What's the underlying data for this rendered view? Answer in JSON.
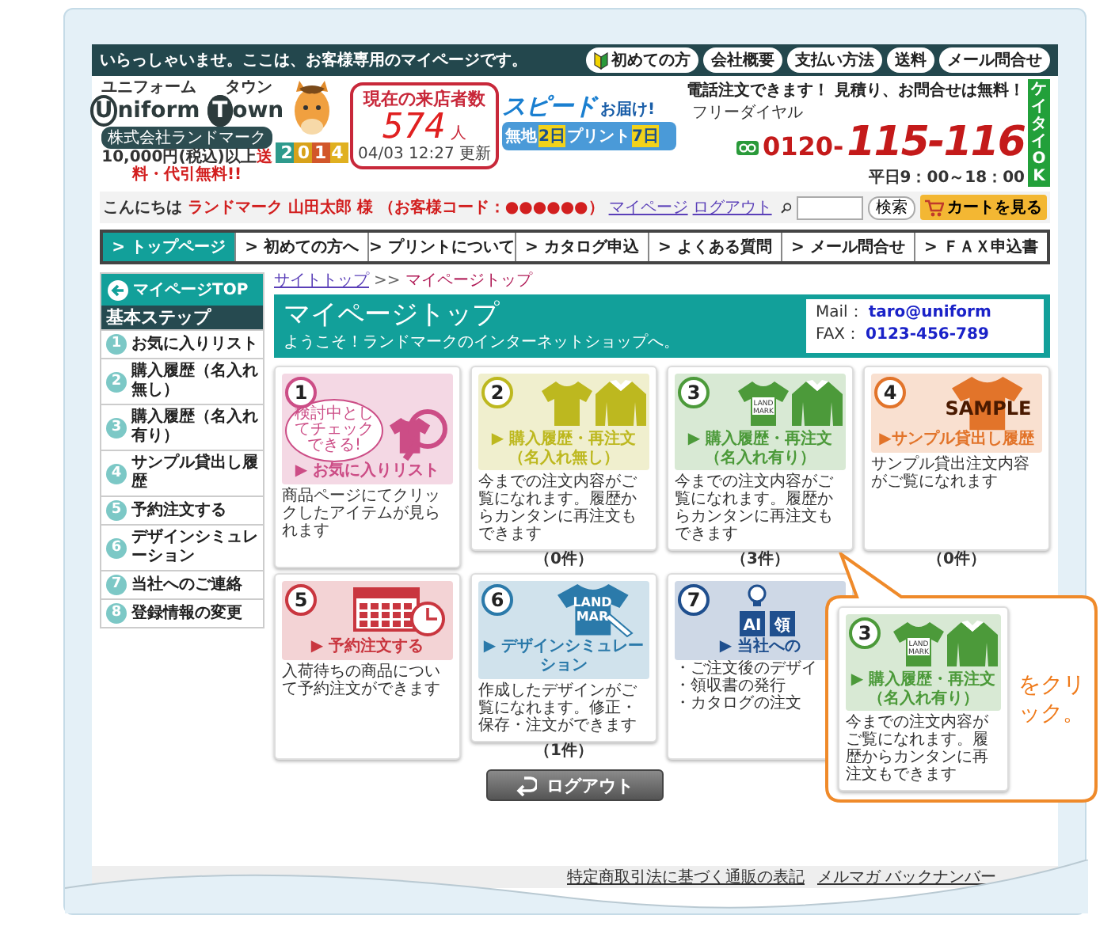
{
  "topbar": {
    "greeting": "いらっしゃいませ。ここは、お客様専用のマイページです。",
    "links": [
      {
        "label": "初めての方",
        "kind": "beginner"
      },
      {
        "label": "会社概要",
        "kind": "plain"
      },
      {
        "label": "支払い方法",
        "kind": "plain"
      },
      {
        "label": "送料",
        "kind": "plain"
      },
      {
        "label": "メール問合せ",
        "kind": "plain"
      }
    ]
  },
  "logo": {
    "kana_left": "ユニフォーム",
    "kana_right": "タウン",
    "word_left": "Uniform",
    "word_right": "Town",
    "company": "株式会社ランドマーク",
    "note": "10,000円(税込)以上",
    "note_highlight": "送料・代引無料!!"
  },
  "mascot": {
    "year": "2014"
  },
  "counter": {
    "label": "現在の来店者数",
    "count": "574",
    "unit": "人",
    "updated": "04/03 12:27 更新"
  },
  "speed_banner": {
    "title": "スピード",
    "tag": "お届け!",
    "plain": "無地",
    "plain_days": "2日",
    "print": "プリント",
    "print_days": "7日"
  },
  "phone": {
    "headline": "電話注文できます！ 見積り、お問合せは無料！",
    "label": "フリーダイヤル",
    "prefix": "0120-",
    "number": "115-116",
    "hours": "平日9：00～18：00",
    "mobile_badge": "ケイタイOK"
  },
  "user_bar": {
    "hello": "こんにちは",
    "user": "ランドマーク 山田太郎 様 （お客様コード：●●●●●●）",
    "links": [
      "マイページ",
      "ログアウト"
    ],
    "search_button": "検索",
    "cart_button": "カートを見る"
  },
  "nav": [
    {
      "label": "> トップページ",
      "selected": true
    },
    {
      "label": "> 初めての方へ",
      "selected": false
    },
    {
      "label": "> プリントについて",
      "selected": false
    },
    {
      "label": "> カタログ申込",
      "selected": false
    },
    {
      "label": "> よくある質問",
      "selected": false
    },
    {
      "label": "> メール問合せ",
      "selected": false
    },
    {
      "label": "> ＦＡＸ申込書",
      "selected": false
    }
  ],
  "sidebar": {
    "top_button": "マイページTOP",
    "heading": "基本ステップ",
    "items": [
      {
        "number": "1",
        "label": "お気に入りリスト"
      },
      {
        "number": "2",
        "label": "購入履歴（名入れ無し）"
      },
      {
        "number": "3",
        "label": "購入履歴（名入れ有り）"
      },
      {
        "number": "4",
        "label": "サンプル貸出し履歴"
      },
      {
        "number": "5",
        "label": "予約注文する"
      },
      {
        "number": "6",
        "label": "デザインシミュレーション"
      },
      {
        "number": "7",
        "label": "当社へのご連絡"
      },
      {
        "number": "8",
        "label": "登録情報の変更"
      }
    ]
  },
  "breadcrumb": [
    {
      "label": "サイトトップ",
      "kind": "link"
    },
    {
      "label": ">>",
      "kind": "separator"
    },
    {
      "label": "マイページトップ",
      "kind": "current"
    }
  ],
  "header": {
    "title": "マイページトップ",
    "subtitle": "ようこそ！ランドマークのインターネットショップへ。",
    "contacts": [
      {
        "label": "Mail：",
        "value": "taro@uniform"
      },
      {
        "label": "FAX：",
        "value": "0123-456-789"
      }
    ]
  },
  "cards": [
    {
      "number": "1",
      "kind": "favorite",
      "color": "#cc4d86",
      "art_labels": [
        "検討中としてチェックできる!"
      ],
      "title": "▶ お気に入りリスト",
      "description": "商品ページにてクリックしたアイテムが見られます"
    },
    {
      "number": "2",
      "kind": "shirts",
      "color": "#bdb81f",
      "title": "▶ 購入履歴・再注文",
      "subtitle": "（名入れ無し）",
      "description": "今までの注文内容がご覧になれます。履歴からカンタンに再注文もできます",
      "count": "（0件）"
    },
    {
      "number": "3",
      "kind": "shirts-logo",
      "color": "#4c9a3a",
      "art_labels": [
        "LAND",
        "MARK"
      ],
      "title": "▶ 購入履歴・再注文",
      "subtitle": "（名入れ有り）",
      "description": "今までの注文内容がご覧になれます。履歴からカンタンに再注文もできます",
      "count": "（3件）"
    },
    {
      "number": "4",
      "kind": "sample",
      "color": "#e2742a",
      "art_labels": [
        "SAMPLE"
      ],
      "title": "▶サンプル貸出し履歴",
      "description": "サンプル貸出注文内容がご覧になれます",
      "count": "（0件）"
    },
    {
      "number": "5",
      "kind": "calendar",
      "color": "#c9363f",
      "title": "▶ 予約注文する",
      "description": "入荷待ちの商品について予約注文ができます"
    },
    {
      "number": "6",
      "kind": "shirt-pen",
      "color": "#2b7aaa",
      "art_labels": [
        "LAND",
        "MAR"
      ],
      "title": "▶ デザインシミュレーション",
      "description": "作成したデザインがご覧になれます。修正・保存・注文ができます",
      "count": "（1件）"
    },
    {
      "number": "7",
      "kind": "bulb",
      "color": "#1f4f8e",
      "art_labels": [
        "AI",
        "領"
      ],
      "title": "▶ 当社への",
      "bullets": [
        "・ご注文後のデザイ",
        "・領収書の発行",
        "・カタログの注文"
      ]
    }
  ],
  "callout": {
    "card": {
      "number": "3",
      "kind": "shirts-logo",
      "color": "#4c9a3a",
      "art_labels": [
        "LAND",
        "MARK"
      ],
      "title": "▶ 購入履歴・再注文",
      "subtitle": "（名入れ有り）",
      "description": "今までの注文内容がご覧になれます。履歴からカンタンに再注文もできます"
    },
    "text": "をクリック。"
  },
  "logout_button": "ログアウト",
  "footer_links": [
    "特定商取引法に基づく通販の表記",
    "メルマガ バックナンバー"
  ]
}
